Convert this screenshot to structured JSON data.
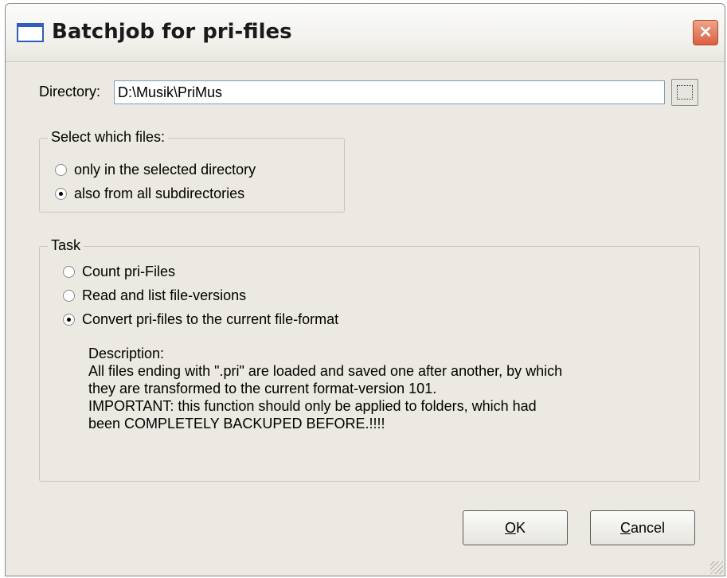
{
  "window": {
    "title": "Batchjob for pri-files",
    "close_label": "✕"
  },
  "directory": {
    "label": "Directory:",
    "value": "D:\\Musik\\PriMus",
    "browse_label": ""
  },
  "file_selection": {
    "legend": "Select which files:",
    "options": [
      {
        "label": "only in the selected directory",
        "checked": false
      },
      {
        "label": "also from all subdirectories",
        "checked": true
      }
    ]
  },
  "task": {
    "legend": "Task",
    "options": [
      {
        "label": "Count pri-Files",
        "checked": false
      },
      {
        "label": "Read and list file-versions",
        "checked": false
      },
      {
        "label": "Convert pri-files to the current file-format",
        "checked": true
      }
    ],
    "description": [
      "Description:",
      "All files ending with \".pri\" are loaded and saved one after another, by which",
      "they are transformed to the current format-version 101.",
      "IMPORTANT: this function should only be applied to folders, which had",
      "been COMPLETELY BACKUPED BEFORE.!!!!"
    ]
  },
  "buttons": {
    "ok_mnemonic": "O",
    "ok_rest": "K",
    "cancel_mnemonic": "C",
    "cancel_rest": "ancel"
  }
}
